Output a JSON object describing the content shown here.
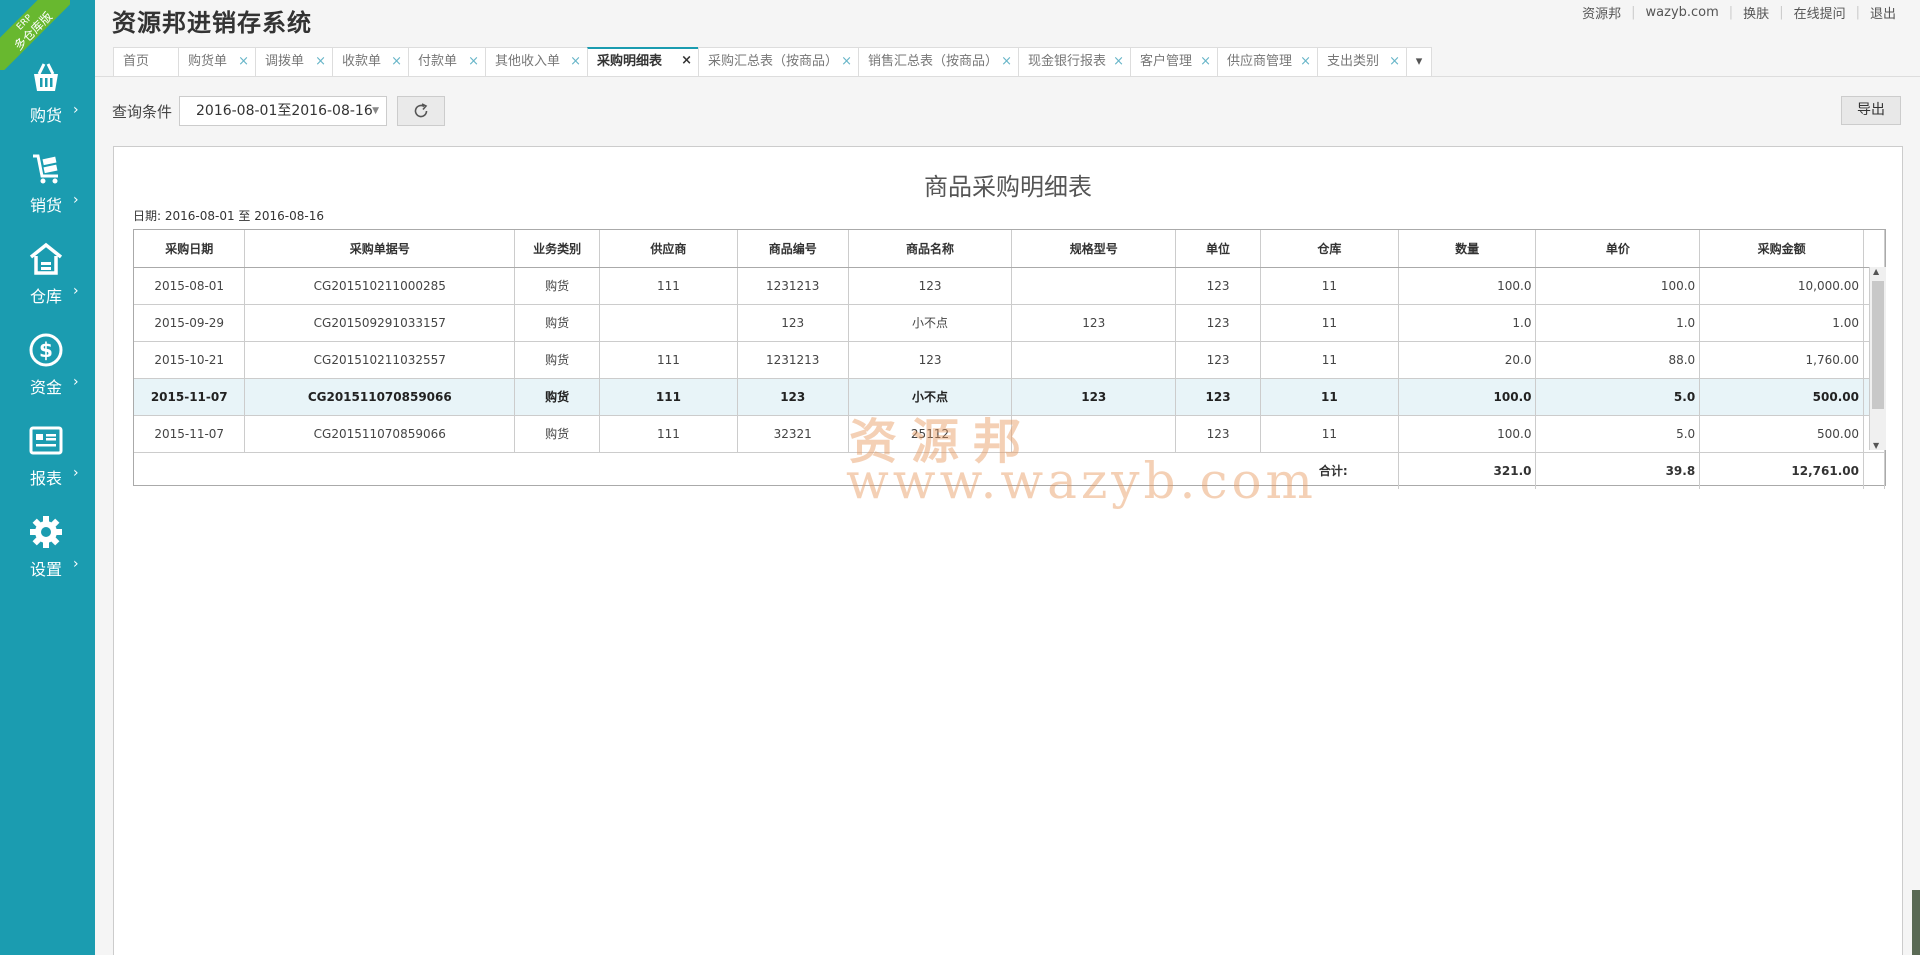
{
  "app": {
    "title": "资源邦进销存系统",
    "ribbon_top": "ERP",
    "ribbon_bottom": "多仓库版"
  },
  "top_links": [
    "资源邦",
    "wazyb.com",
    "换肤",
    "在线提问",
    "退出"
  ],
  "sidebar": {
    "items": [
      {
        "label": "购货",
        "icon": "basket-icon"
      },
      {
        "label": "销货",
        "icon": "cart-icon"
      },
      {
        "label": "仓库",
        "icon": "warehouse-icon"
      },
      {
        "label": "资金",
        "icon": "dollar-icon"
      },
      {
        "label": "报表",
        "icon": "report-icon"
      },
      {
        "label": "设置",
        "icon": "gear-icon"
      }
    ],
    "arrow": "›"
  },
  "tabs": [
    {
      "label": "首页",
      "closable": false
    },
    {
      "label": "购货单",
      "closable": true
    },
    {
      "label": "调拨单",
      "closable": true
    },
    {
      "label": "收款单",
      "closable": true
    },
    {
      "label": "付款单",
      "closable": true
    },
    {
      "label": "其他收入单",
      "closable": true
    },
    {
      "label": "采购明细表",
      "closable": true,
      "active": true
    },
    {
      "label": "采购汇总表（按商品）",
      "closable": true
    },
    {
      "label": "销售汇总表（按商品）",
      "closable": true
    },
    {
      "label": "现金银行报表",
      "closable": true
    },
    {
      "label": "客户管理",
      "closable": true
    },
    {
      "label": "供应商管理",
      "closable": true
    },
    {
      "label": "支出类别",
      "closable": true
    }
  ],
  "query": {
    "label": "查询条件",
    "date_range": "2016-08-01至2016-08-16",
    "export_label": "导出"
  },
  "report": {
    "title": "商品采购明细表",
    "date_info": "日期: 2016-08-01 至 2016-08-16",
    "columns": [
      "采购日期",
      "采购单据号",
      "业务类别",
      "供应商",
      "商品编号",
      "商品名称",
      "规格型号",
      "单位",
      "仓库",
      "数量",
      "单价",
      "采购金额"
    ],
    "rows": [
      [
        "2015-08-01",
        "CG201510211000285",
        "购货",
        "111",
        "1231213",
        "123",
        "",
        "123",
        "11",
        "100.0",
        "100.0",
        "10,000.00"
      ],
      [
        "2015-09-29",
        "CG201509291033157",
        "购货",
        "",
        "123",
        "小不点",
        "123",
        "123",
        "11",
        "1.0",
        "1.0",
        "1.00"
      ],
      [
        "2015-10-21",
        "CG201510211032557",
        "购货",
        "111",
        "1231213",
        "123",
        "",
        "123",
        "11",
        "20.0",
        "88.0",
        "1,760.00"
      ],
      [
        "2015-11-07",
        "CG201511070859066",
        "购货",
        "111",
        "123",
        "小不点",
        "123",
        "123",
        "11",
        "100.0",
        "5.0",
        "500.00"
      ],
      [
        "2015-11-07",
        "CG201511070859066",
        "购货",
        "111",
        "32321",
        "25112",
        "",
        "123",
        "11",
        "100.0",
        "5.0",
        "500.00"
      ]
    ],
    "selected_row": 3,
    "total_label": "合计:",
    "totals": {
      "qty": "321.0",
      "price": "39.8",
      "amount": "12,761.00"
    }
  },
  "watermark": {
    "line1": "资源邦",
    "line2": "www.wazyb.com"
  }
}
